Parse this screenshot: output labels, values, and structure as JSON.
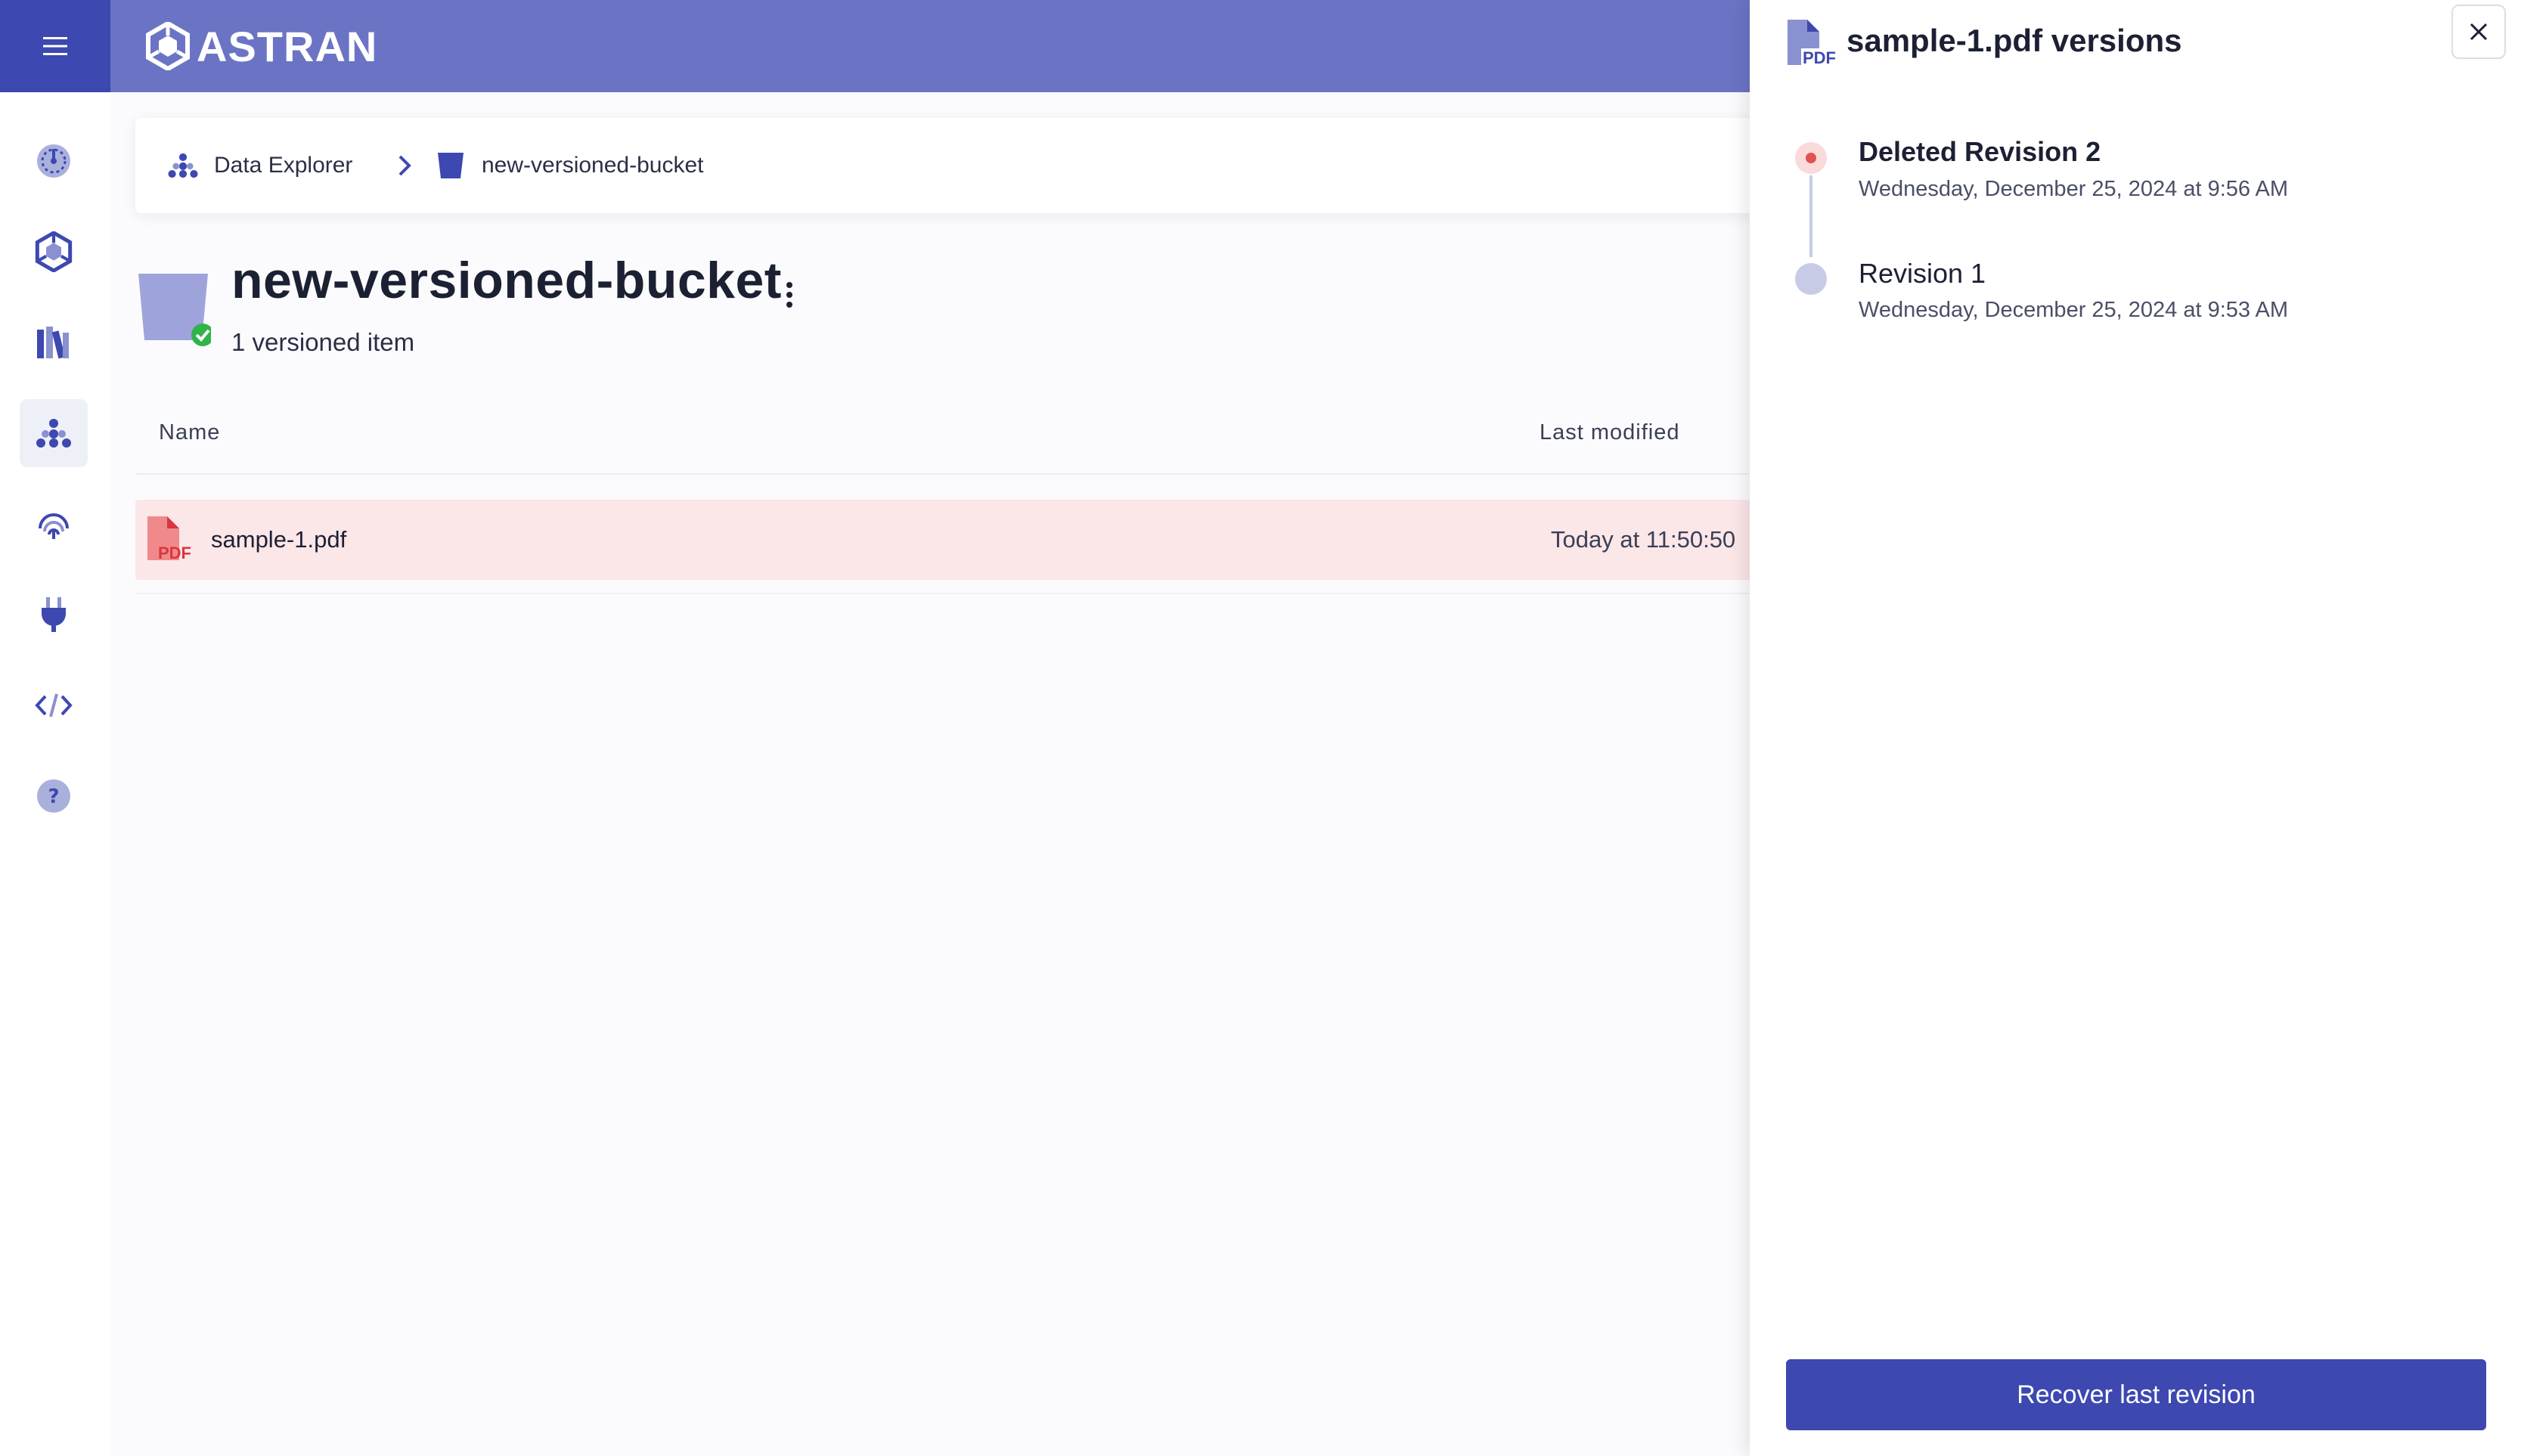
{
  "brand": {
    "name": "ASTRAN"
  },
  "colors": {
    "primary": "#3d48b0",
    "topbar": "#6b74c4",
    "deleted": "#e05252",
    "row_highlight": "#fbe6e8",
    "success": "#2fb44a"
  },
  "sidebar": {
    "items": [
      {
        "icon": "dashboard-icon"
      },
      {
        "icon": "hexagon-network-icon"
      },
      {
        "icon": "library-icon"
      },
      {
        "icon": "hierarchy-icon",
        "active": true
      },
      {
        "icon": "fingerprint-icon"
      },
      {
        "icon": "plug-icon"
      },
      {
        "icon": "code-icon"
      },
      {
        "icon": "help-icon"
      }
    ]
  },
  "breadcrumb": {
    "root": "Data Explorer",
    "current": "new-versioned-bucket"
  },
  "bucket": {
    "name": "new-versioned-bucket",
    "summary": "1 versioned item"
  },
  "table": {
    "headers": {
      "name": "Name",
      "last_modified": "Last modified"
    },
    "rows": [
      {
        "name": "sample-1.pdf",
        "type_badge": "PDF",
        "last_modified": "Today at 11:50:50",
        "deleted": true
      }
    ]
  },
  "drawer": {
    "title": "sample-1.pdf versions",
    "file_badge": "PDF",
    "revisions": [
      {
        "title": "Deleted Revision 2",
        "date": "Wednesday, December 25, 2024 at 9:56 AM",
        "deleted": true
      },
      {
        "title": "Revision 1",
        "date": "Wednesday, December 25, 2024 at 9:53 AM",
        "deleted": false
      }
    ],
    "recover_label": "Recover last revision"
  }
}
